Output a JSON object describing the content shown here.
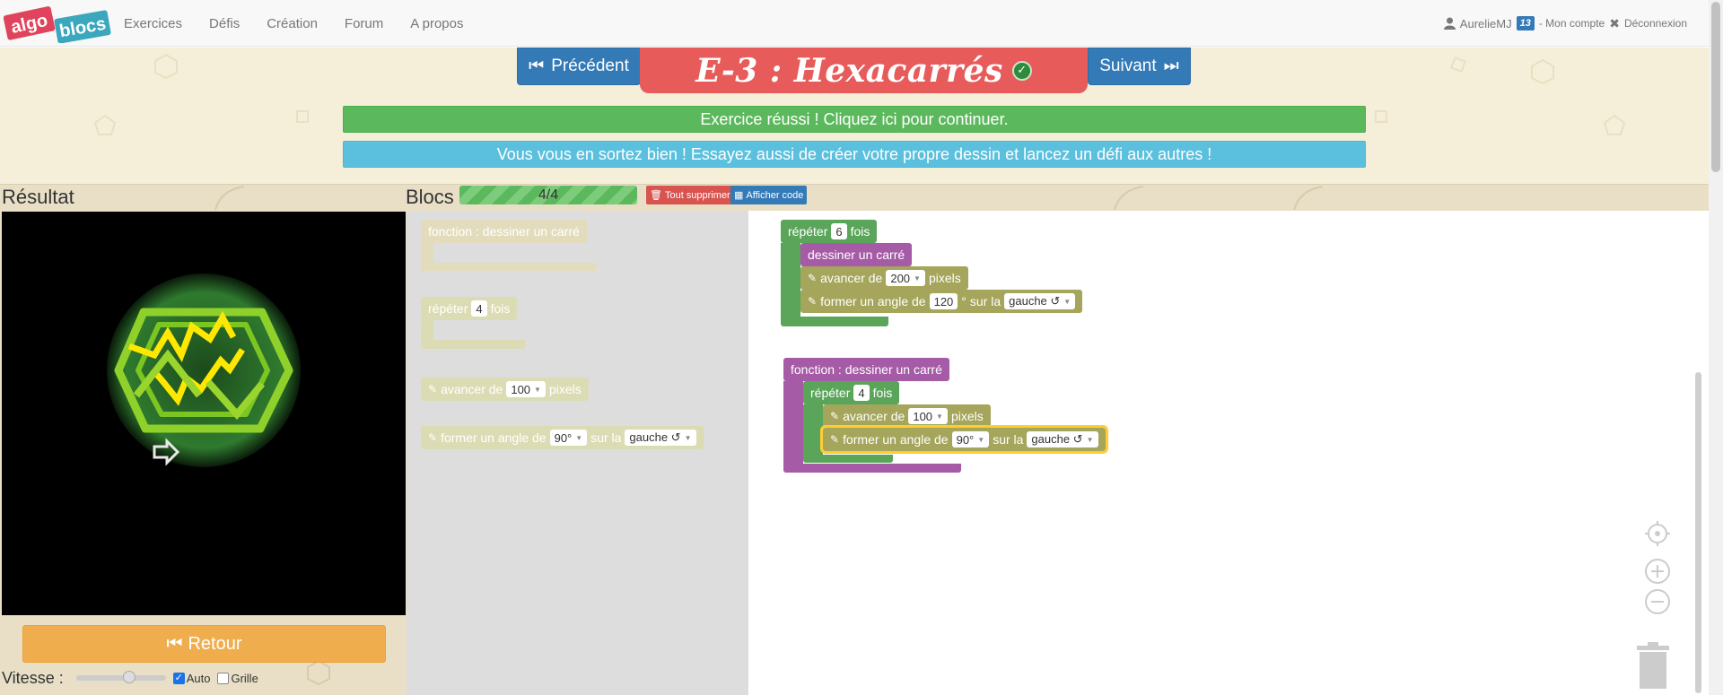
{
  "navbar": {
    "logo_left": "algo",
    "logo_right": "blocs",
    "links": [
      "Exercices",
      "Défis",
      "Création",
      "Forum",
      "A propos"
    ],
    "user_name": "AurelieMJ",
    "level": "13",
    "account_link": "- Mon compte",
    "logout_link": "Déconnexion"
  },
  "header": {
    "prev_label": "Précédent",
    "next_label": "Suivant",
    "title": "E-3 : Hexacarrés",
    "success_text": "Exercice réussi ! Cliquez ici pour continuer.",
    "info_text": "Vous vous en sortez bien ! Essayez aussi de créer votre propre dessin et lancez un défi aux autres !"
  },
  "result_panel": {
    "title": "Résultat",
    "back_label": "Retour",
    "speed_label": "Vitesse :",
    "auto_label": "Auto",
    "auto_checked": true,
    "grid_label": "Grille",
    "grid_checked": false,
    "speed_level": 0.6
  },
  "blocks_panel": {
    "title": "Blocs",
    "progress_text": "4/4",
    "progress_value": 1.0,
    "delete_all_label": "Tout supprimer",
    "show_code_label": "Afficher code"
  },
  "toolbox": {
    "function_label": "fonction : dessiner un carré",
    "repeat_prefix": "répéter",
    "repeat_value": "4",
    "repeat_suffix": "fois",
    "forward_prefix": "avancer de",
    "forward_value": "100",
    "forward_suffix": "pixels",
    "turn_prefix": "former un angle de",
    "turn_value": "90°",
    "turn_mid": "sur la",
    "turn_direction": "gauche ↺"
  },
  "workspace": {
    "main": {
      "repeat_prefix": "répéter",
      "repeat_value": "6",
      "repeat_suffix": "fois",
      "call_label": "dessiner un carré",
      "forward_prefix": "avancer de",
      "forward_value": "200",
      "forward_suffix": "pixels",
      "turn_prefix": "former un angle de",
      "turn_value": "120",
      "turn_unit": "°",
      "turn_mid": "sur la",
      "turn_direction": "gauche ↺"
    },
    "function": {
      "header": "fonction : dessiner un carré",
      "repeat_prefix": "répéter",
      "repeat_value": "4",
      "repeat_suffix": "fois",
      "forward_prefix": "avancer de",
      "forward_value": "100",
      "forward_suffix": "pixels",
      "turn_prefix": "former un angle de",
      "turn_value": "90°",
      "turn_mid": "sur la",
      "turn_direction": "gauche ↺"
    }
  },
  "colors": {
    "title_red": "#e85b5b",
    "nav_blue": "#337ab7",
    "success_green": "#5cb85c",
    "info_blue": "#5bc0de",
    "retour_orange": "#f0ad4e",
    "block_green": "#5ba55b",
    "block_olive": "#a5a55c",
    "block_purple": "#a55ba5"
  },
  "icons": [
    "user-icon",
    "close-icon",
    "step-backward-icon",
    "step-forward-icon",
    "check-circle-icon",
    "trash-icon",
    "table-icon",
    "fast-backward-icon",
    "pencil-icon",
    "target-icon",
    "zoom-in-icon",
    "zoom-out-icon",
    "turtle-arrow-icon"
  ]
}
